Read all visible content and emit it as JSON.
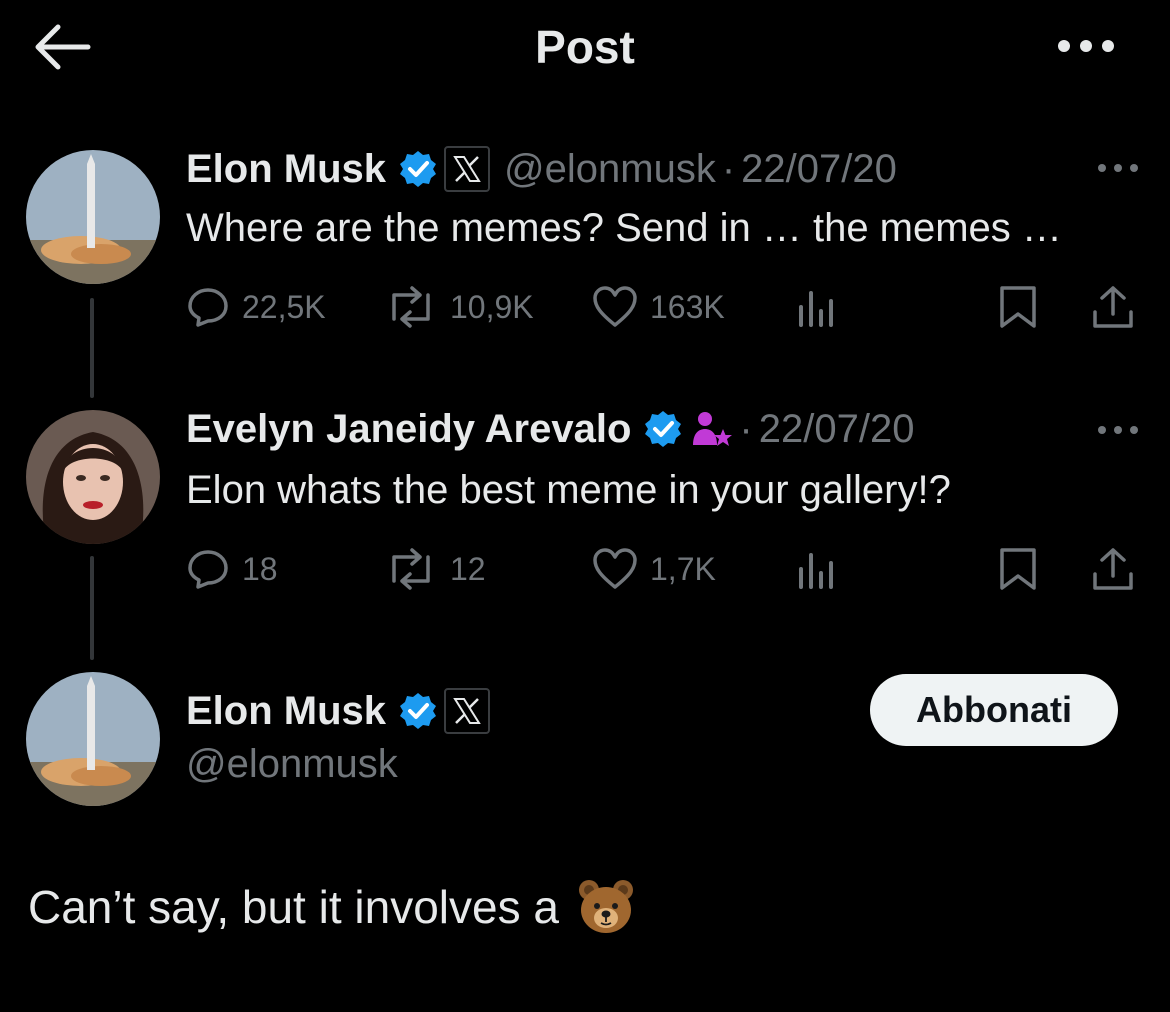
{
  "header": {
    "title": "Post",
    "back_icon": "arrow-left-icon",
    "more_icon": "more-horizontal-icon"
  },
  "thread": [
    {
      "name": "Elon Musk",
      "verified": true,
      "affiliate_badge": "x-logo",
      "handle": "@elonmusk",
      "separator": "·",
      "date": "22/07/20",
      "text": "Where are the memes? Send in … the memes …",
      "replies": "22,5K",
      "reposts": "10,9K",
      "likes": "163K"
    },
    {
      "name": "Evelyn Janeidy Arevalo",
      "verified": true,
      "affiliate_badge": "person-star-icon",
      "separator": "·",
      "date": "22/07/20",
      "text": "Elon whats the best meme in your gallery!?",
      "replies": "18",
      "reposts": "12",
      "likes": "1,7K"
    }
  ],
  "main_post": {
    "name": "Elon Musk",
    "verified": true,
    "affiliate_badge": "x-logo",
    "handle": "@elonmusk",
    "follow_label": "Abbonati",
    "text": "Can’t say, but it involves a",
    "emoji": "bear-face-emoji"
  },
  "colors": {
    "background": "#000000",
    "text": "#e7e9ea",
    "muted": "#71767b",
    "verified": "#1d9bf0",
    "affiliate_purple": "#c13ad6"
  }
}
